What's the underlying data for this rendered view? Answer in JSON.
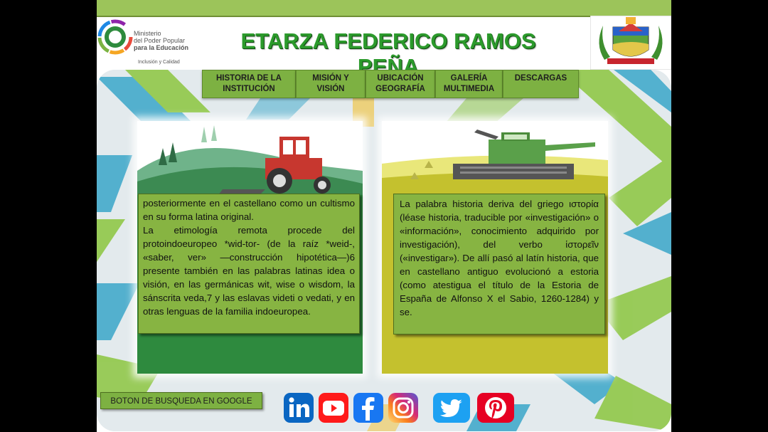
{
  "header": {
    "title": "ETARZA FEDERICO RAMOS PEÑA",
    "logo_text_lines": [
      "Ministerio",
      "del Poder Popular",
      "para la Educación"
    ],
    "logo_subtext": "Inclusión y Calidad"
  },
  "nav": {
    "items": [
      {
        "line1": "HISTORIA DE LA",
        "line2": "INSTITUCIÓN"
      },
      {
        "line1": "MISIÓN Y",
        "line2": "VISIÓN"
      },
      {
        "line1": "UBICACIÓN",
        "line2": "GEOGRAFÍA"
      },
      {
        "line1": "GALERÍA",
        "line2": "MULTIMEDIA"
      },
      {
        "line1": "DESCARGAS",
        "line2": ""
      }
    ]
  },
  "left_card": {
    "paragraph1": "posteriormente en el castellano como un cultismo en su forma latina original.",
    "paragraph2": "La etimología remota procede del protoindoeuropeo *wid-tor- (de la raíz *weid-, «saber, ver» —construcción hipotética—)6 presente también en las palabras latinas idea o visión, en las germánicas wit, wise o wisdom, la sánscrita veda,7 y las eslavas videti o vedati, y en otras lenguas de la familia indoeuropea."
  },
  "right_card": {
    "paragraph1": "La palabra historia deriva del griego ιστορία (léase historia, traducible por «investigación» o «información», conocimiento adquirido por investigación), del verbo ἱστορεῖν («investigar»). De allí pasó al latín historia, que en castellano antiguo evolucionó a estoria (como atestigua el título de la Estoria de España de Alfonso X el Sabio, 1260-1284) y se."
  },
  "footer": {
    "google_button_label": "BOTON DE BUSQUEDA EN GOOGLE",
    "social_icons": [
      "linkedin-icon",
      "youtube-icon",
      "facebook-icon",
      "instagram-icon",
      "twitter-icon",
      "pinterest-icon"
    ]
  },
  "colors": {
    "title_green": "#2c9a2c",
    "nav_green": "#7db142",
    "left_card_green": "#2e8a3e",
    "right_card_yellow": "#c4c12e",
    "linkedin": "#0a66c2",
    "youtube": "#ff0000",
    "facebook": "#1877f2",
    "twitter": "#1da1f2",
    "pinterest": "#e60023"
  }
}
